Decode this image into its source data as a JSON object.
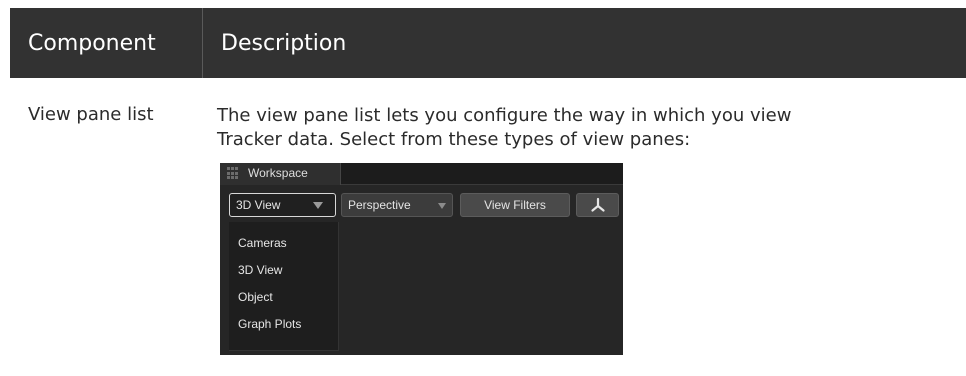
{
  "table": {
    "headers": {
      "component": "Component",
      "description": "Description"
    },
    "row": {
      "component": "View pane list",
      "description_lines": [
        "The view pane list lets you configure the way in which you view",
        "Tracker data. Select from these types of view panes:"
      ]
    }
  },
  "screenshot": {
    "tab": {
      "label": "Workspace",
      "icon": "grid-icon"
    },
    "toolbar": {
      "view_select": "3D View",
      "perspective_select": "Perspective",
      "filters_button": "View Filters",
      "axis_button_icon": "axis-icon"
    },
    "dropdown_items": [
      "Cameras",
      "3D View",
      "Object",
      "Graph Plots"
    ]
  },
  "colors": {
    "header_bg": "#323232",
    "ui_bg": "#262626",
    "accent_border": "#d8d8d8"
  }
}
